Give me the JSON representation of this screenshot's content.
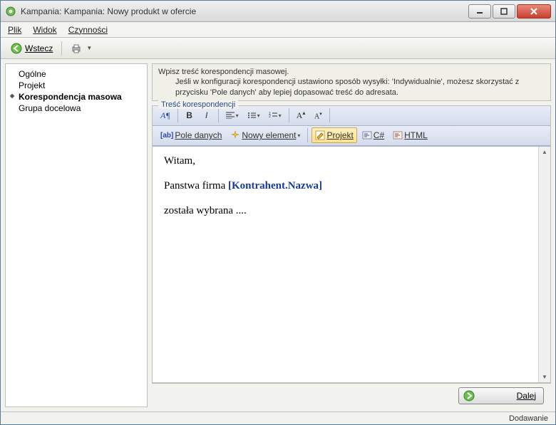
{
  "window": {
    "title": "Kampania: Kampania: Nowy produkt w ofercie"
  },
  "menubar": {
    "file": "Plik",
    "view": "Widok",
    "actions": "Czynności"
  },
  "toolbar": {
    "back": "Wstecz"
  },
  "sidebar": {
    "items": [
      {
        "label": "Ogólne"
      },
      {
        "label": "Projekt"
      },
      {
        "label": "Korespondencja masowa"
      },
      {
        "label": "Grupa docelowa"
      }
    ],
    "active_index": 2
  },
  "info": {
    "line1": "Wpisz treść korespondencji masowej.",
    "line2": "Jeśli w konfiguracji korespondencji ustawiono sposób wysyłki: 'Indywidualnie',  możesz skorzystać z przycisku 'Pole danych' aby lepiej dopasować treść do adresata."
  },
  "group": {
    "legend": "Treść korespondencji"
  },
  "editor_toolbar": {
    "style_btn": "A¶",
    "field_data": "Pole danych",
    "new_element": "Nowy element",
    "design": "Projekt",
    "csharp": "C#",
    "html": "HTML"
  },
  "editor": {
    "greeting": "Witam,",
    "line2_prefix": "Panstwa firma  ",
    "placeholder": "[Kontrahent.Nazwa]",
    "line3": "została wybrana ...."
  },
  "footer": {
    "next": "Dalej"
  },
  "status": {
    "mode": "Dodawanie"
  }
}
